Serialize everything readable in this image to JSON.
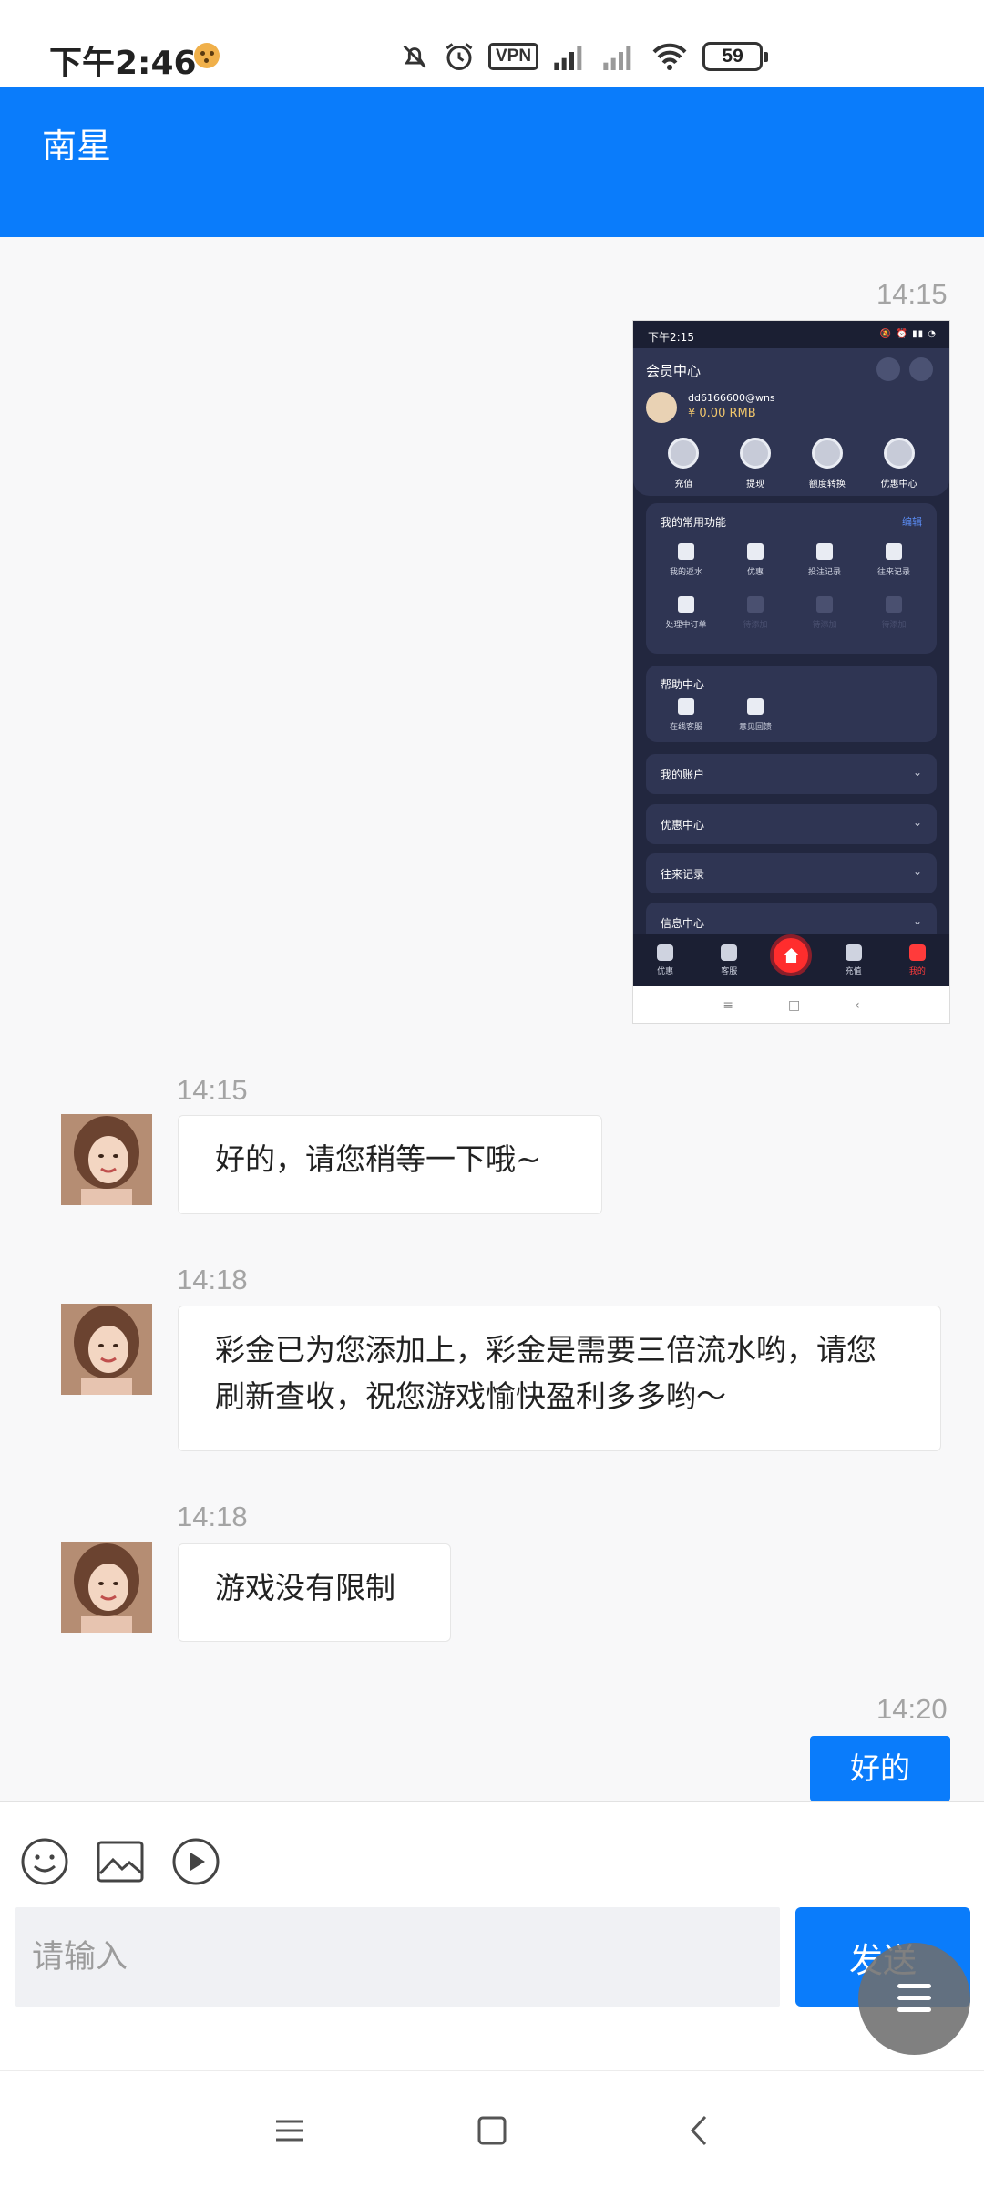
{
  "status_bar": {
    "time": "下午2:46",
    "vpn": "VPN",
    "battery": "59"
  },
  "header": {
    "title": "南星"
  },
  "messages": [
    {
      "time": "14:15",
      "from": "me",
      "type": "image"
    },
    {
      "time": "14:15",
      "from": "agent",
      "text": "好的，请您稍等一下哦~"
    },
    {
      "time": "14:18",
      "from": "agent",
      "text": "彩金已为您添加上，彩金是需要三倍流水哟，请您刷新查收，祝您游戏愉快盈利多多哟～"
    },
    {
      "time": "14:18",
      "from": "agent",
      "text": "游戏没有限制"
    },
    {
      "time": "14:20",
      "from": "me",
      "text": "好的"
    }
  ],
  "embedded_screenshot": {
    "status_time": "下午2:15",
    "title": "会员中心",
    "username": "dd6166600@wns",
    "balance": "¥ 0.00 RMB",
    "actions": [
      "充值",
      "提现",
      "额度转换",
      "优惠中心"
    ],
    "common_title": "我的常用功能",
    "edit": "编辑",
    "common_items": [
      "我的返水",
      "优惠",
      "投注记录",
      "往来记录",
      "处理中订单",
      "待添加",
      "待添加",
      "待添加"
    ],
    "help_title": "帮助中心",
    "help_items": [
      "在线客服",
      "意见回馈"
    ],
    "rows": [
      "我的账户",
      "优惠中心",
      "往来记录",
      "信息中心"
    ],
    "tabs": [
      "优惠",
      "客服",
      "充值",
      "我的"
    ]
  },
  "composer": {
    "placeholder": "请输入",
    "send_label": "发送"
  }
}
